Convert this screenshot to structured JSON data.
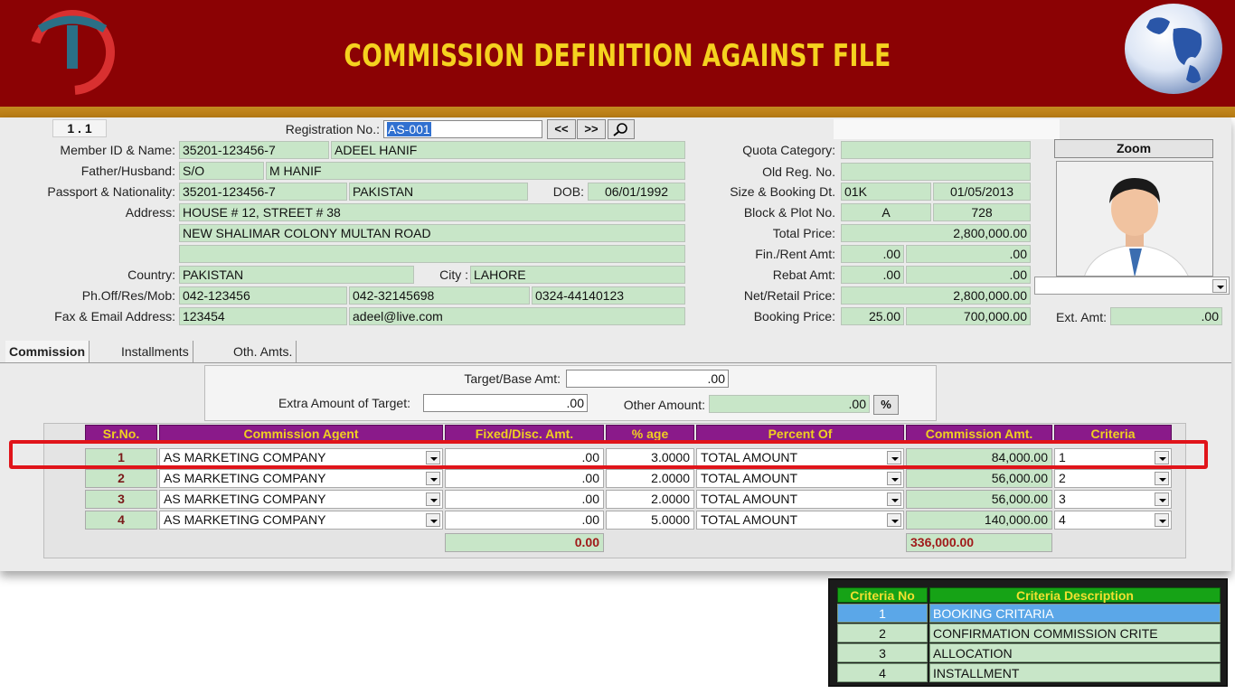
{
  "banner": {
    "title": "COMMISSION DEFINITION AGAINST FILE"
  },
  "form": {
    "counter": "1 . 1",
    "registration_label": "Registration No.:",
    "registration_value": "AS-001",
    "nav_prev": "<<",
    "nav_next": ">>",
    "member_label": "Member ID & Name:",
    "member_id": "35201-123456-7",
    "member_name": "ADEEL HANIF",
    "father_label": "Father/Husband:",
    "relation": "S/O",
    "father_name": "M HANIF",
    "passport_label": "Passport & Nationality:",
    "passport": "35201-123456-7",
    "nationality": "PAKISTAN",
    "dob_label": "DOB:",
    "dob": "06/01/1992",
    "address_label": "Address:",
    "address1": "HOUSE # 12, STREET # 38",
    "address2": "NEW SHALIMAR COLONY MULTAN ROAD",
    "address3": "",
    "country_label": "Country:",
    "country": "PAKISTAN",
    "city_label": "City :",
    "city": "LAHORE",
    "phone_label": "Ph.Off/Res/Mob:",
    "phone_off": "042-123456",
    "phone_res": "042-32145698",
    "phone_mob": "0324-44140123",
    "fax_label": "Fax & Email Address:",
    "fax": "123454",
    "email": "adeel@live.com",
    "quota_label": "Quota Category:",
    "quota": "",
    "oldreg_label": "Old Reg. No.",
    "oldreg": "",
    "size_label": "Size & Booking Dt.",
    "size": "01K",
    "booking_date": "01/05/2013",
    "block_label": "Block & Plot No.",
    "block": "A",
    "plot": "728",
    "total_label": "Total Price:",
    "total": "2,800,000.00",
    "fin_label": "Fin./Rent Amt:",
    "fin_a": ".00",
    "fin_b": ".00",
    "rebat_label": "Rebat Amt:",
    "rebat_a": ".00",
    "rebat_b": ".00",
    "net_label": "Net/Retail Price:",
    "net": "2,800,000.00",
    "booking_label": "Booking Price:",
    "booking_pct": "25.00",
    "booking_amt": "700,000.00",
    "ext_label": "Ext. Amt:",
    "ext": ".00",
    "zoom_label": "Zoom"
  },
  "tabs": [
    "Commission",
    "Installments",
    "Oth. Amts."
  ],
  "targets": {
    "target_label": "Target/Base Amt:",
    "target": ".00",
    "extra_label": "Extra Amount of Target:",
    "extra": ".00",
    "other_label": "Other Amount:",
    "other": ".00"
  },
  "grid": {
    "headers": [
      "Sr.No.",
      "Commission Agent",
      "Fixed/Disc. Amt.",
      "% age",
      "Percent Of",
      "Commission Amt.",
      "Criteria"
    ],
    "rows": [
      {
        "sr": "1",
        "agent": "AS MARKETING COMPANY",
        "fixed": ".00",
        "pct": "3.0000",
        "of": "TOTAL AMOUNT",
        "amt": "84,000.00",
        "crit": "1"
      },
      {
        "sr": "2",
        "agent": "AS MARKETING COMPANY",
        "fixed": ".00",
        "pct": "2.0000",
        "of": "TOTAL AMOUNT",
        "amt": "56,000.00",
        "crit": "2"
      },
      {
        "sr": "3",
        "agent": "AS MARKETING COMPANY",
        "fixed": ".00",
        "pct": "2.0000",
        "of": "TOTAL AMOUNT",
        "amt": "56,000.00",
        "crit": "3"
      },
      {
        "sr": "4",
        "agent": "AS MARKETING COMPANY",
        "fixed": ".00",
        "pct": "5.0000",
        "of": "TOTAL AMOUNT",
        "amt": "140,000.00",
        "crit": "4"
      }
    ],
    "total_fixed": "0.00",
    "total_amt": "336,000.00"
  },
  "criteria": {
    "headers": [
      "Criteria No",
      "Criteria Description"
    ],
    "rows": [
      {
        "no": "1",
        "desc": "BOOKING CRITARIA"
      },
      {
        "no": "2",
        "desc": "CONFIRMATION COMMISSION CRITE"
      },
      {
        "no": "3",
        "desc": "ALLOCATION"
      },
      {
        "no": "4",
        "desc": "INSTALLMENT"
      }
    ]
  },
  "colors": {
    "banner": "#8b0204",
    "title": "#f5d21f",
    "field": "#c8e6c8",
    "grid_header": "#8a1a8a",
    "highlight": "#e0141a"
  }
}
